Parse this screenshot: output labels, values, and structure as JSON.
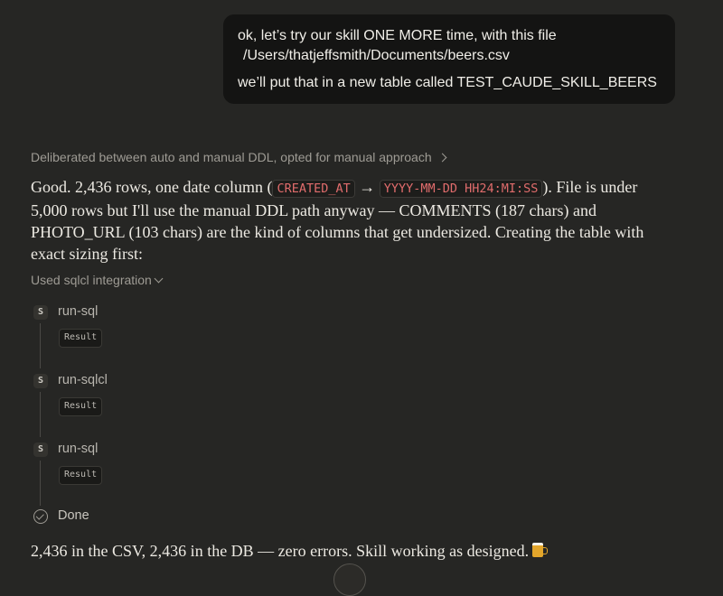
{
  "user_message": {
    "line1": "ok, let’s try our skill ONE MORE time, with this file",
    "line2": "/Users/thatjeffsmith/Documents/beers.csv",
    "line3": "we’ll put that in a new table called TEST_CAUDE_SKILL_BEERS"
  },
  "thinking_summary": "Deliberated between auto and manual DDL, opted for manual approach",
  "response": {
    "part1": "Good. 2,436 rows, one date column (",
    "code1": "CREATED_AT",
    "arrow": "→",
    "code2": "YYYY-MM-DD HH24:MI:SS",
    "part2": "). File is under 5,000 rows but I'll use the manual DDL path anyway — COMMENTS (187 chars) and PHOTO_URL (103 chars) are the kind of columns that get undersized. Creating the table with exact sizing first:"
  },
  "integration_label": "Used sqlcl integration",
  "steps": [
    {
      "badge": "S",
      "title": "run-sql",
      "result": "Result"
    },
    {
      "badge": "S",
      "title": "run-sqlcl",
      "result": "Result"
    },
    {
      "badge": "S",
      "title": "run-sql",
      "result": "Result"
    }
  ],
  "done_label": "Done",
  "final_message": "2,436 in the CSV, 2,436 in the DB — zero errors. Skill working as designed.",
  "icons": {
    "thinking_expand": "chevron-right-icon",
    "integration_expand": "chevron-down-icon",
    "done": "check-circle-icon",
    "emoji": "beer-mug-icon"
  }
}
